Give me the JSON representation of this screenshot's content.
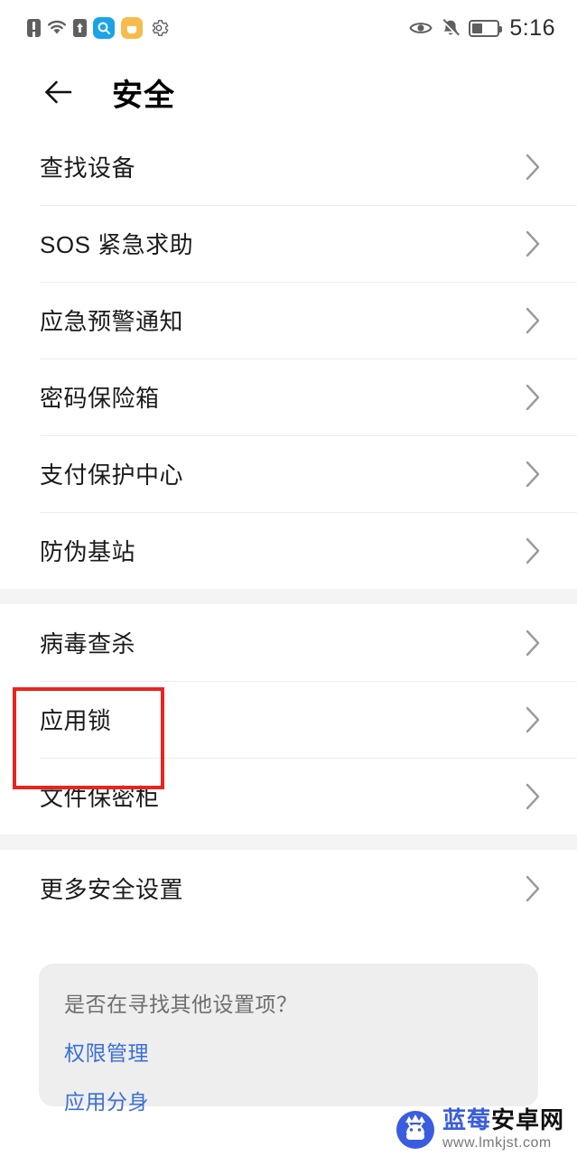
{
  "status_bar": {
    "icons_left": [
      "sim-alert-icon",
      "wifi-icon",
      "upload-icon",
      "search-badge-icon",
      "capsule-badge-icon",
      "gear-icon"
    ],
    "icons_right": [
      "eye-icon",
      "bell-muted-icon",
      "battery-icon"
    ],
    "battery_percent": 40,
    "time": "5:16"
  },
  "header": {
    "back_icon": "back-arrow-icon",
    "title": "安全"
  },
  "sections": [
    {
      "rows": [
        {
          "label": "查找设备"
        },
        {
          "label": "SOS 紧急求助"
        },
        {
          "label": "应急预警通知"
        },
        {
          "label": "密码保险箱"
        },
        {
          "label": "支付保护中心"
        },
        {
          "label": "防伪基站"
        }
      ]
    },
    {
      "rows": [
        {
          "label": "病毒查杀"
        },
        {
          "label": "应用锁"
        },
        {
          "label": "文件保密柜"
        }
      ]
    },
    {
      "rows": [
        {
          "label": "更多安全设置"
        }
      ]
    }
  ],
  "highlight": {
    "target_label": "应用锁",
    "color": "#e8241f"
  },
  "suggestion_card": {
    "title": "是否在寻找其他设置项？",
    "links": [
      {
        "label": "权限管理"
      },
      {
        "label": "应用分身"
      }
    ],
    "link_color": "#3a6fd8"
  },
  "watermark": {
    "logo": "android-head-logo",
    "name_part1": "蓝莓",
    "name_part2": "安卓网",
    "url": "www.lmkjst.com"
  }
}
